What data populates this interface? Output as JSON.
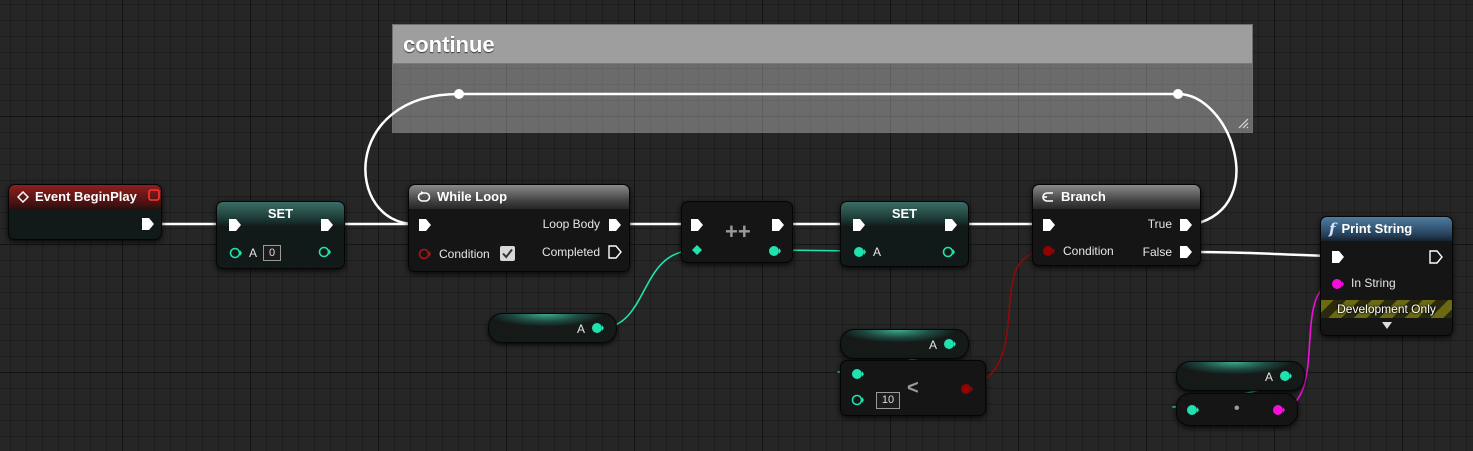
{
  "comment": {
    "title": "continue"
  },
  "event_begin_play": {
    "title": "Event BeginPlay"
  },
  "set_a_zero": {
    "title": "SET",
    "var_label": "A",
    "value": "0"
  },
  "while_loop": {
    "title": "While Loop",
    "condition_label": "Condition",
    "loop_body_label": "Loop Body",
    "completed_label": "Completed",
    "condition_checked": true
  },
  "increment": {
    "symbol": "++"
  },
  "set_a": {
    "title": "SET",
    "var_label": "A"
  },
  "get_a_1": {
    "label": "A"
  },
  "branch": {
    "title": "Branch",
    "condition_label": "Condition",
    "true_label": "True",
    "false_label": "False"
  },
  "get_a_2": {
    "label": "A"
  },
  "less_than": {
    "symbol": "<",
    "value": "10"
  },
  "get_a_3": {
    "label": "A"
  },
  "to_string": {
    "symbol": "•"
  },
  "print_string": {
    "title": "Print String",
    "in_string_label": "In String",
    "dev_only_label": "Development Only"
  },
  "colors": {
    "exec": "#ffffff",
    "int": "#1fe3ae",
    "bool": "#950000",
    "string": "#f30fdb",
    "event_header": "#8e1f1f",
    "function_header": "#4f7da2"
  }
}
